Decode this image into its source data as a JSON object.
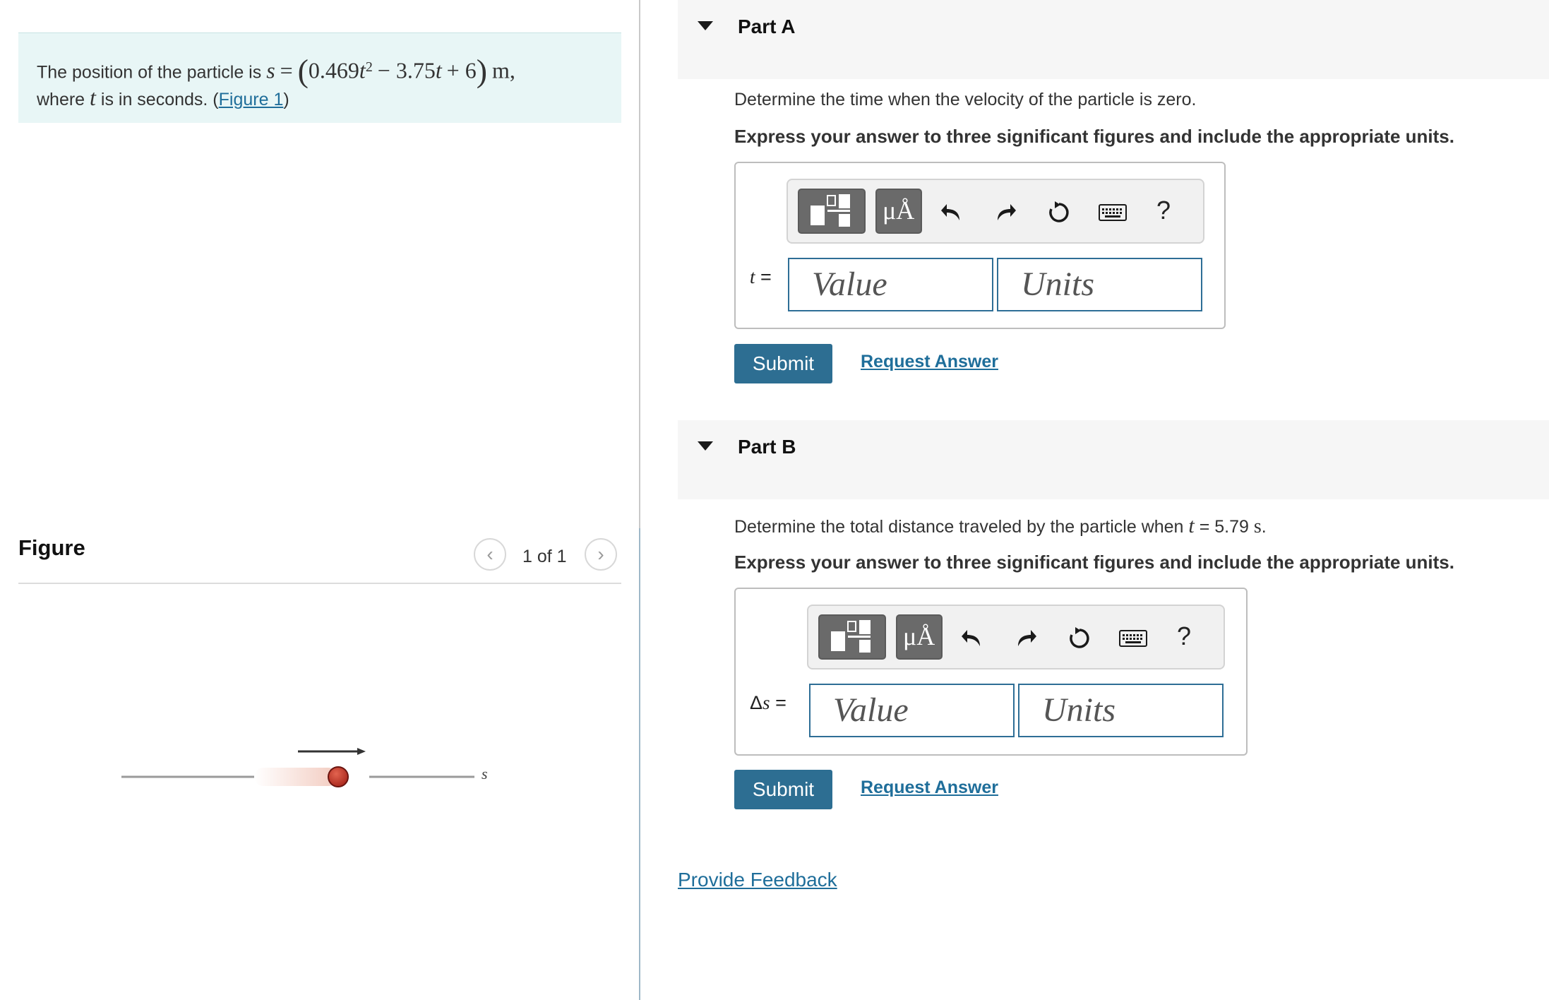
{
  "problem": {
    "intro": "The position of the particle is",
    "lhs": "s",
    "coef1": "0.469",
    "var_t": "t",
    "exp": "2",
    "minus_term": "− 3.75",
    "plus_term": "+ 6",
    "unit": "m,",
    "line2_before": "where",
    "line2_after": "is in seconds. (",
    "figure_link": "Figure 1",
    "close_paren": ")"
  },
  "figure": {
    "title": "Figure",
    "counter": "1 of 1",
    "axis_label": "s"
  },
  "part_a": {
    "title": "Part A",
    "question": "Determine the time when the velocity of the particle is zero.",
    "instruction": "Express your answer to three significant figures and include the appropriate units.",
    "var_label": "t",
    "equals": "=",
    "value_placeholder": "Value",
    "units_placeholder": "Units",
    "submit_label": "Submit",
    "request_label": "Request Answer"
  },
  "part_b": {
    "title": "Part B",
    "question_before": "Determine the total distance traveled by the particle when",
    "question_var": "t",
    "question_after": "= 5.79",
    "question_unit": "s",
    "question_end": ".",
    "instruction": "Express your answer to three significant figures and include the appropriate units.",
    "var_delta": "Δ",
    "var_label": "s",
    "equals": "=",
    "value_placeholder": "Value",
    "units_placeholder": "Units",
    "submit_label": "Submit",
    "request_label": "Request Answer"
  },
  "toolbar": {
    "units_glyph": "μÅ",
    "help_glyph": "?",
    "icons": [
      "templates-icon",
      "units-icon",
      "undo-icon",
      "redo-icon",
      "reset-icon",
      "keyboard-icon",
      "help-icon"
    ]
  },
  "footer": {
    "feedback_label": "Provide Feedback"
  },
  "colors": {
    "accent": "#2d6e92",
    "link": "#1f6e9a",
    "problem_bg": "#e8f6f6",
    "particle": "#c0392b"
  }
}
